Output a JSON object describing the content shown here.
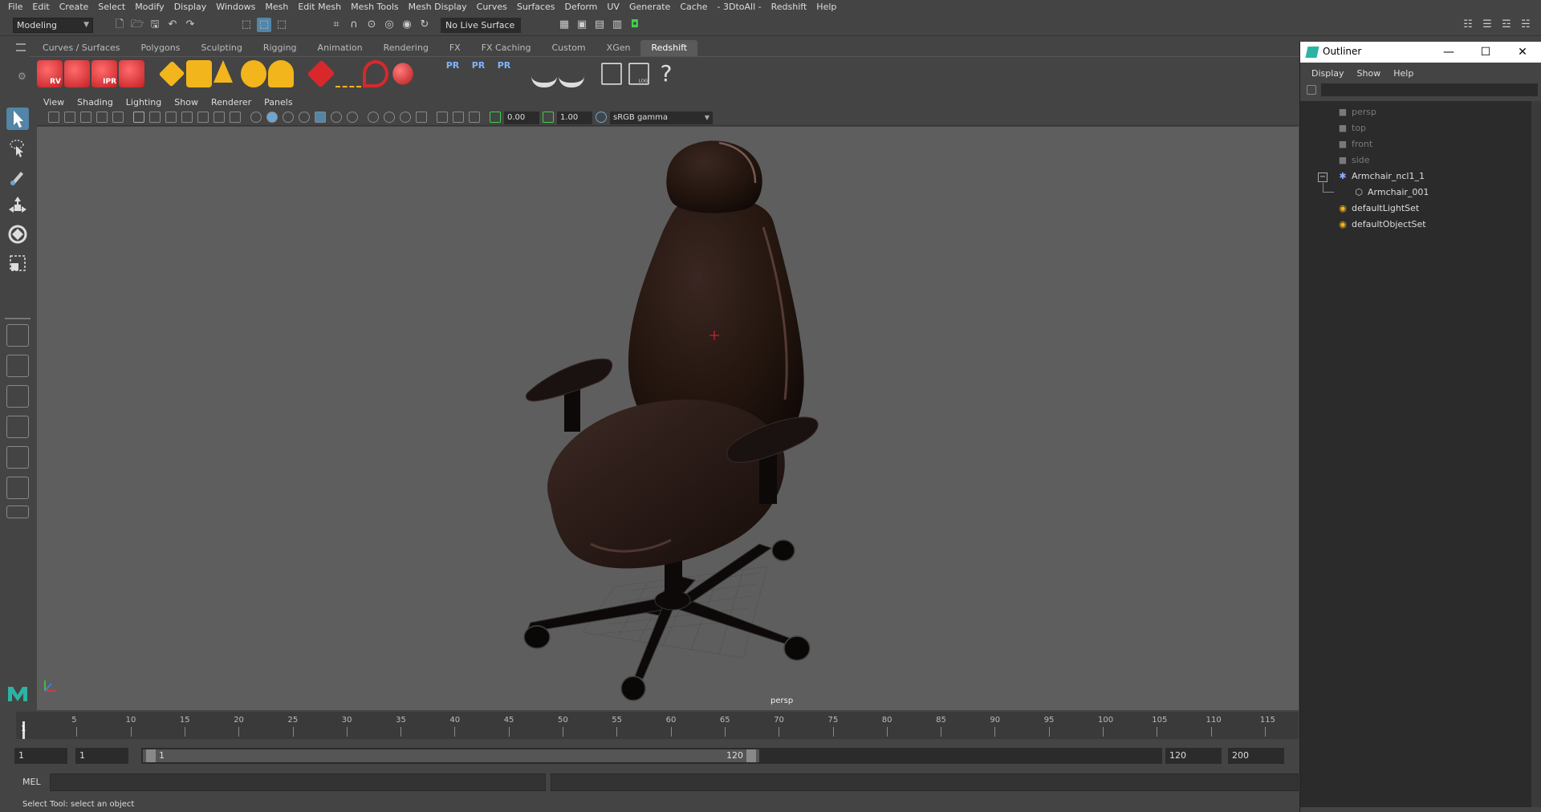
{
  "menubar": {
    "items": [
      "File",
      "Edit",
      "Create",
      "Select",
      "Modify",
      "Display",
      "Windows",
      "Mesh",
      "Edit Mesh",
      "Mesh Tools",
      "Mesh Display",
      "Curves",
      "Surfaces",
      "Deform",
      "UV",
      "Generate",
      "Cache",
      "- 3DtoAll -",
      "Redshift",
      "Help"
    ]
  },
  "statusline": {
    "mode": "Modeling",
    "live_surface": "No Live Surface"
  },
  "shelf": {
    "tabs": [
      "Curves / Surfaces",
      "Polygons",
      "Sculpting",
      "Rigging",
      "Animation",
      "Rendering",
      "FX",
      "FX Caching",
      "Custom",
      "XGen",
      "Redshift"
    ],
    "active_tab": "Redshift",
    "icon_labels": {
      "rv": "RV",
      "ipr": "IPR",
      "pr1": "PR",
      "pr2": "PR",
      "pr3": "PR",
      "log": "LOG",
      "help": "?"
    }
  },
  "panel": {
    "menu": [
      "View",
      "Shading",
      "Lighting",
      "Show",
      "Renderer",
      "Panels"
    ],
    "exposure": "0.00",
    "gamma": "1.00",
    "color_space": "sRGB gamma",
    "camera_label": "persp"
  },
  "timeline": {
    "ticks": [
      "5",
      "10",
      "15",
      "20",
      "25",
      "30",
      "35",
      "40",
      "45",
      "50",
      "55",
      "60",
      "65",
      "70",
      "75",
      "80",
      "85",
      "90",
      "95",
      "100",
      "105",
      "110",
      "115"
    ],
    "current_frame": "1"
  },
  "range": {
    "start": "1",
    "playback_start": "1",
    "handle_start": "1",
    "handle_end": "120",
    "playback_end": "120",
    "end": "200"
  },
  "commandline": {
    "label": "MEL"
  },
  "helpline": {
    "text": "Select Tool: select an object"
  },
  "outliner": {
    "title": "Outliner",
    "menu": [
      "Display",
      "Show",
      "Help"
    ],
    "items": [
      {
        "label": "persp",
        "icon": "camera-icon",
        "dim": true
      },
      {
        "label": "top",
        "icon": "camera-icon",
        "dim": true
      },
      {
        "label": "front",
        "icon": "camera-icon",
        "dim": true
      },
      {
        "label": "side",
        "icon": "camera-icon",
        "dim": true
      },
      {
        "label": "Armchair_ncl1_1",
        "icon": "group-icon",
        "dim": false
      },
      {
        "label": "Armchair_001",
        "icon": "mesh-icon",
        "dim": false
      },
      {
        "label": "defaultLightSet",
        "icon": "set-icon",
        "dim": false
      },
      {
        "label": "defaultObjectSet",
        "icon": "set-icon",
        "dim": false
      }
    ]
  },
  "colors": {
    "accent": "#5285a6",
    "redshift_red": "#d8282c",
    "shelf_yellow": "#f2b51c",
    "viewport_bg": "#5e5e5e",
    "chair": "#2a1b18"
  }
}
